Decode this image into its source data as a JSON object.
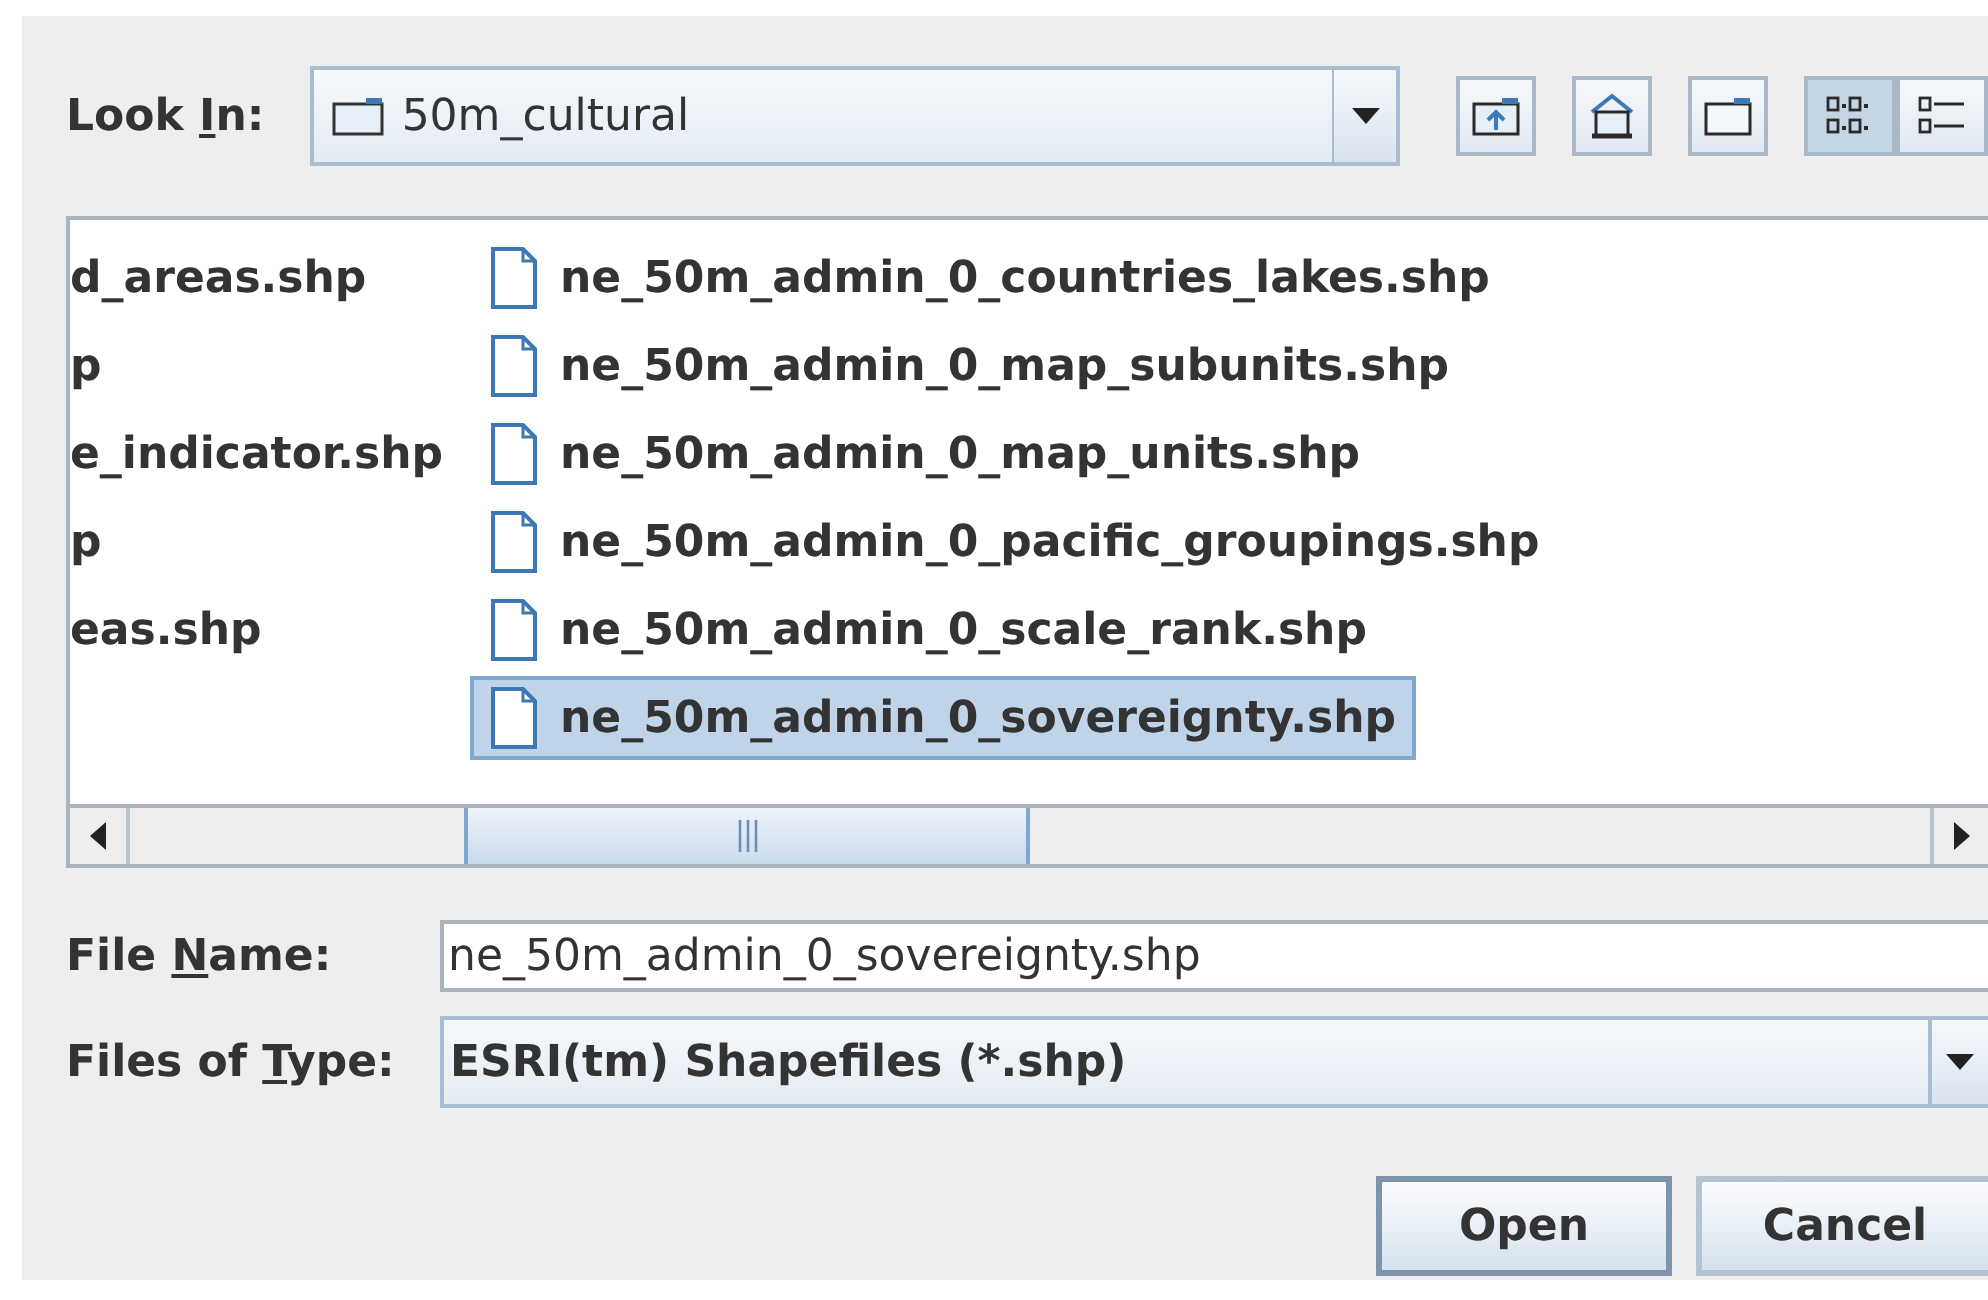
{
  "look_in": {
    "label": {
      "before": "Look ",
      "key": "I",
      "after": "n:"
    },
    "value": "50m_cultural"
  },
  "toolbar": [
    {
      "kind": "up"
    },
    {
      "kind": "home"
    },
    {
      "kind": "new_folder"
    },
    {
      "kind": "list",
      "selected": true
    },
    {
      "kind": "details",
      "selected": false
    }
  ],
  "file_list": {
    "clipped_column": [
      "d_areas.shp",
      "p",
      "e_indicator.shp",
      "p",
      "eas.shp"
    ],
    "column": [
      {
        "name": "ne_50m_admin_0_countries_lakes.shp",
        "selected": false
      },
      {
        "name": "ne_50m_admin_0_map_subunits.shp",
        "selected": false
      },
      {
        "name": "ne_50m_admin_0_map_units.shp",
        "selected": false
      },
      {
        "name": "ne_50m_admin_0_pacific_groupings.shp",
        "selected": false
      },
      {
        "name": "ne_50m_admin_0_scale_rank.shp",
        "selected": false
      },
      {
        "name": "ne_50m_admin_0_sovereignty.shp",
        "selected": true
      }
    ]
  },
  "file_name": {
    "label": {
      "before": "File ",
      "key": "N",
      "after": "ame:"
    },
    "value": "ne_50m_admin_0_sovereignty.shp"
  },
  "files_of_type": {
    "label": {
      "before": "Files of ",
      "key": "T",
      "after": "ype:"
    },
    "value": "ESRI(tm) Shapefiles (*.shp)"
  },
  "buttons": [
    {
      "label": "Open",
      "default": true
    },
    {
      "label": "Cancel",
      "default": false
    }
  ]
}
